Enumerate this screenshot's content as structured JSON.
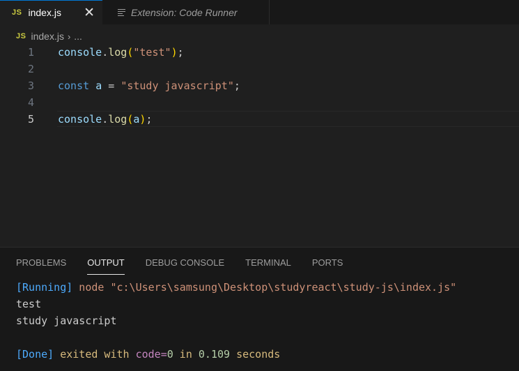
{
  "tabs": [
    {
      "icon": "JS",
      "label": "index.js",
      "close": "✕"
    },
    {
      "label": "Extension: Code Runner"
    }
  ],
  "breadcrumb": {
    "icon": "JS",
    "file": "index.js",
    "sep": "›",
    "more": "..."
  },
  "editor": {
    "lines": [
      {
        "num": "1",
        "tokens": [
          {
            "t": "console",
            "c": "t-var"
          },
          {
            "t": ".",
            "c": "t-pl"
          },
          {
            "t": "log",
            "c": "t-fn"
          },
          {
            "t": "(",
            "c": "t-br"
          },
          {
            "t": "\"test\"",
            "c": "t-str"
          },
          {
            "t": ")",
            "c": "t-br"
          },
          {
            "t": ";",
            "c": "t-pl"
          }
        ]
      },
      {
        "num": "2",
        "tokens": []
      },
      {
        "num": "3",
        "tokens": [
          {
            "t": "const",
            "c": "t-kw"
          },
          {
            "t": " ",
            "c": "t-pl"
          },
          {
            "t": "a",
            "c": "t-var"
          },
          {
            "t": " = ",
            "c": "t-pl"
          },
          {
            "t": "\"study javascript\"",
            "c": "t-str"
          },
          {
            "t": ";",
            "c": "t-pl"
          }
        ]
      },
      {
        "num": "4",
        "tokens": []
      },
      {
        "num": "5",
        "tokens": [
          {
            "t": "console",
            "c": "t-var"
          },
          {
            "t": ".",
            "c": "t-pl"
          },
          {
            "t": "log",
            "c": "t-fn"
          },
          {
            "t": "(",
            "c": "t-br"
          },
          {
            "t": "a",
            "c": "t-var"
          },
          {
            "t": ")",
            "c": "t-br"
          },
          {
            "t": ";",
            "c": "t-pl"
          }
        ]
      }
    ]
  },
  "panel": {
    "tabs": [
      "PROBLEMS",
      "OUTPUT",
      "DEBUG CONSOLE",
      "TERMINAL",
      "PORTS"
    ],
    "active_tab": "OUTPUT"
  },
  "output": {
    "running_tag": "[Running]",
    "running_cmd": " node \"c:\\Users\\samsung\\Desktop\\studyreact\\study-js\\index.js\"",
    "line1": "test",
    "line2": "study javascript",
    "done_tag": "[Done]",
    "done_text1": " exited with ",
    "done_code_label": "code=",
    "done_code": "0",
    "done_in": " in ",
    "done_time": "0.109",
    "done_seconds": " seconds"
  }
}
